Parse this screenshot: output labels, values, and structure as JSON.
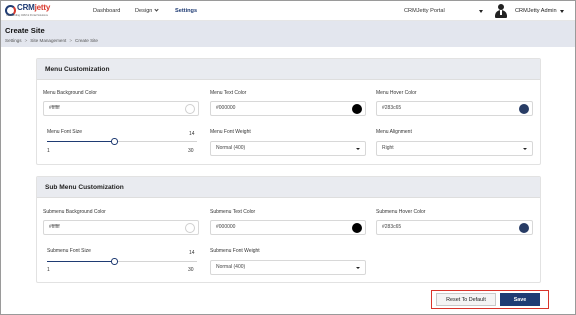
{
  "app": {
    "logo_text_a": "CRM",
    "logo_text_b": "jetty",
    "logo_tagline": "Outstanding CRM & Portal Solutions"
  },
  "nav": {
    "dashboard": "Dashboard",
    "design": "Design",
    "settings": "Settings"
  },
  "header": {
    "portal": "CRMJetty Portal",
    "user": "CRMJetty Admin"
  },
  "page": {
    "title": "Create Site",
    "breadcrumb": [
      "Settings",
      "Site Management",
      "Create Site"
    ]
  },
  "menu": {
    "heading": "Menu Customization",
    "bg_color_label": "Menu Background Color",
    "bg_color_value": "#ffffff",
    "text_color_label": "Menu Text Color",
    "text_color_value": "#000000",
    "hover_color_label": "Menu Hover Color",
    "hover_color_value": "#283c65",
    "font_size_label": "Menu Font Size",
    "font_size_value": "14",
    "font_size_min": "1",
    "font_size_max": "30",
    "font_weight_label": "Menu Font Weight",
    "font_weight_value": "Normal (400)",
    "alignment_label": "Menu Alignment",
    "alignment_value": "Right"
  },
  "submenu": {
    "heading": "Sub Menu Customization",
    "bg_color_label": "Submenu Background Color",
    "bg_color_value": "#ffffff",
    "text_color_label": "Submenu Text Color",
    "text_color_value": "#000000",
    "hover_color_label": "Submenu Hover Color",
    "hover_color_value": "#283c65",
    "font_size_label": "Submenu Font Size",
    "font_size_value": "14",
    "font_size_min": "1",
    "font_size_max": "30",
    "font_weight_label": "Submenu Font Weight",
    "font_weight_value": "Normal (400)"
  },
  "actions": {
    "reset": "Reset To Default",
    "save": "Save"
  },
  "colors": {
    "brand": "#1f3b73",
    "accent_red": "#d9342b",
    "swatch_white": "#ffffff",
    "swatch_black": "#000000",
    "swatch_navy": "#283c65"
  },
  "icons": [
    "logo-icon",
    "chevron-down-icon",
    "caret-down-icon",
    "user-avatar-icon",
    "color-swatch-icon",
    "slider-thumb-icon"
  ]
}
